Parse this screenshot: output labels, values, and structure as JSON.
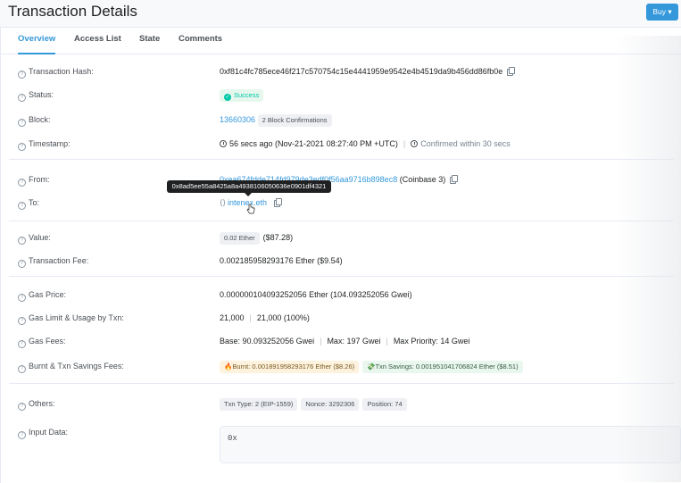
{
  "header": {
    "title": "Transaction Details",
    "buy_label": "Buy"
  },
  "tabs": [
    {
      "label": "Overview",
      "active": true
    },
    {
      "label": "Access List",
      "active": false
    },
    {
      "label": "State",
      "active": false
    },
    {
      "label": "Comments",
      "active": false
    }
  ],
  "fields": {
    "tx_hash": {
      "label": "Transaction Hash:",
      "value": "0xf81c4fc785ece46f217c570754c15e4441959e9542e4b4519da9b456dd86fb0e"
    },
    "status": {
      "label": "Status:",
      "value": "Success"
    },
    "block": {
      "label": "Block:",
      "value": "13660306",
      "confirmations": "2 Block Confirmations"
    },
    "timestamp": {
      "label": "Timestamp:",
      "value": "56 secs ago (Nov-21-2021 08:27:40 PM +UTC)",
      "confirmed": "Confirmed within 30 secs"
    },
    "from": {
      "label": "From:",
      "value": "0xea674fdde714fd979de3edf0f56aa9716b898ec8",
      "name": "(Coinbase 3)"
    },
    "to": {
      "label": "To:",
      "value": "intenex.eth",
      "tooltip": "0x8ad5ee55a8425a8a4938106050636e0901df4321"
    },
    "value": {
      "label": "Value:",
      "badge": "0.02 Ether",
      "usd": "($87.28)"
    },
    "tx_fee": {
      "label": "Transaction Fee:",
      "value": "0.002185958293176 Ether ($9.54)"
    },
    "gas_price": {
      "label": "Gas Price:",
      "value": "0.000000104093252056 Ether (104.093252056 Gwei)"
    },
    "gas_limit": {
      "label": "Gas Limit & Usage by Txn:",
      "limit": "21,000",
      "usage": "21,000 (100%)"
    },
    "gas_fees": {
      "label": "Gas Fees:",
      "base": "Base: 90.093252056 Gwei",
      "max": "Max: 197 Gwei",
      "max_priority": "Max Priority: 14 Gwei"
    },
    "burnt": {
      "label": "Burnt & Txn Savings Fees:",
      "burnt": "Burnt: 0.001891958293176 Ether ($8.26)",
      "savings": "Txn Savings: 0.001951041706824 Ether ($8.51)"
    },
    "others": {
      "label": "Others:",
      "txn_type": "Txn Type: 2 (EIP-1559)",
      "nonce": "Nonce: 3292306",
      "position": "Position: 74"
    },
    "input_data": {
      "label": "Input Data:",
      "value": "0x"
    }
  },
  "colors": {
    "accent": "#3498db",
    "success": "#00c9a7",
    "text": "#1e2022",
    "muted": "#77838f"
  }
}
